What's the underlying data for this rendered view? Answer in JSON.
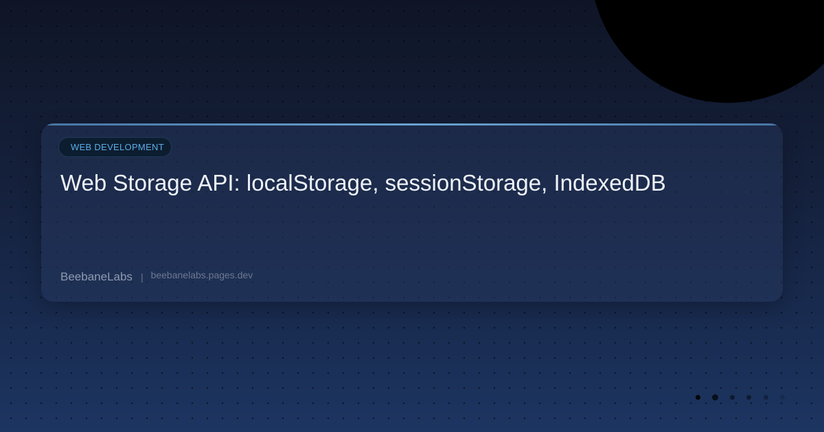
{
  "post": {
    "category": "WEB DEVELOPMENT",
    "title": "Web Storage API: localStorage, sessionStorage, IndexedDB"
  },
  "footer": {
    "brand": "BeebaneLabs",
    "separator": "|",
    "domain": "beebanelabs.pages.dev"
  },
  "colors": {
    "background_top": "#0f1526",
    "background_bottom": "#1c3561",
    "card_accent": "#6aa3d0",
    "badge_text": "#5aaee6",
    "title_text": "#eef2f8"
  }
}
